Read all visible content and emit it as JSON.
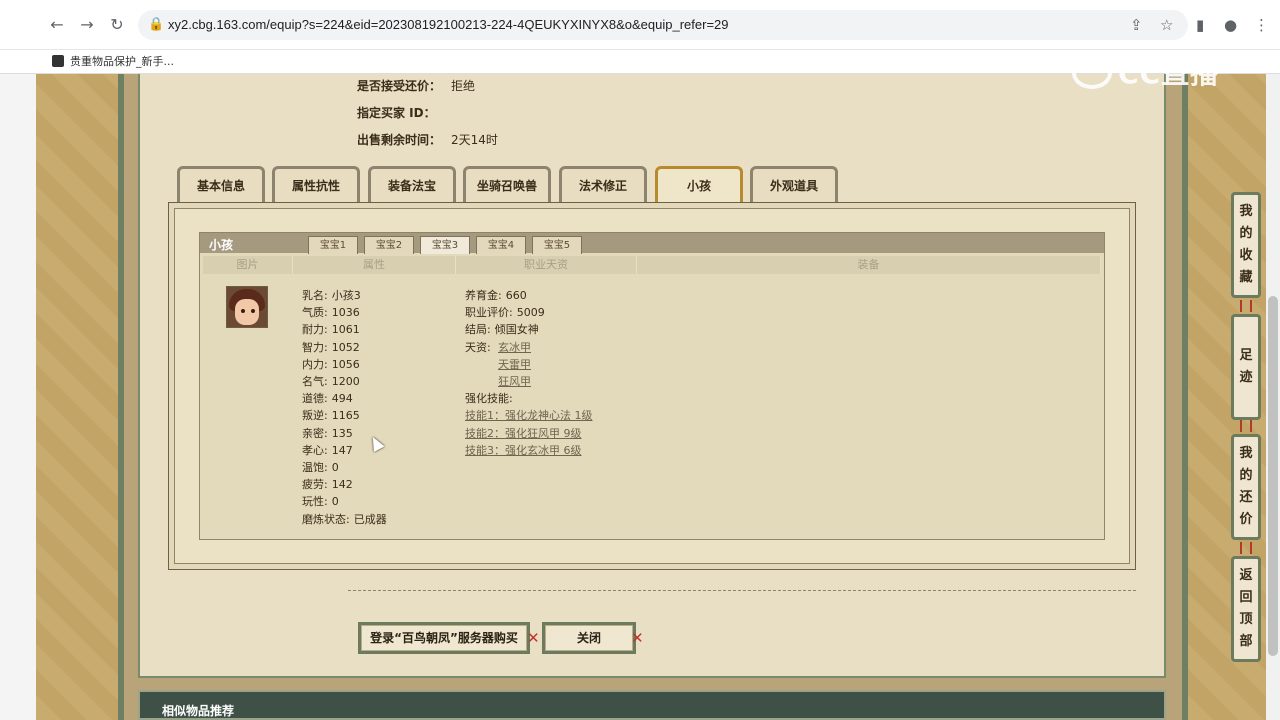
{
  "browser": {
    "url": "xy2.cbg.163.com/equip?s=224&eid=202308192100213-224-4QEUKYXINYX8&o&equip_refer=29",
    "bookmark": "贵重物品保护_新手..."
  },
  "watermark": "CC直播",
  "info": {
    "counter_offer_label": "是否接受还价：",
    "counter_offer_value": "拒绝",
    "buyer_label": "指定买家 ID：",
    "buyer_value": "",
    "remaining_label": "出售剩余时间：",
    "remaining_value": "2天14时"
  },
  "tabs": [
    "基本信息",
    "属性抗性",
    "装备法宝",
    "坐骑召唤兽",
    "法术修正",
    "小孩",
    "外观道具"
  ],
  "child": {
    "title": "小孩",
    "subtabs": [
      "宝宝1",
      "宝宝2",
      "宝宝3",
      "宝宝4",
      "宝宝5"
    ],
    "columns": [
      "图片",
      "属性",
      "职业天资",
      "装备"
    ],
    "attrs": [
      {
        "k": "乳名:",
        "v": "小孩3"
      },
      {
        "k": "气质:",
        "v": "1036"
      },
      {
        "k": "耐力:",
        "v": "1061"
      },
      {
        "k": "智力:",
        "v": "1052"
      },
      {
        "k": "内力:",
        "v": "1056"
      },
      {
        "k": "名气:",
        "v": "1200"
      },
      {
        "k": "道德:",
        "v": "494"
      },
      {
        "k": "叛逆:",
        "v": "1165"
      },
      {
        "k": "亲密:",
        "v": "135"
      },
      {
        "k": "孝心:",
        "v": "147"
      },
      {
        "k": "温饱:",
        "v": "0"
      },
      {
        "k": "疲劳:",
        "v": "142"
      },
      {
        "k": "玩性:",
        "v": "0"
      },
      {
        "k": "磨炼状态:",
        "v": "已成器"
      }
    ],
    "career": {
      "fee_label": "养育金:",
      "fee_value": "660",
      "score_label": "职业评价:",
      "score_value": "5009",
      "ending_label": "结局:",
      "ending_value": "倾国女神",
      "talent_label": "天资:",
      "talents": [
        "玄冰甲",
        "天雷甲",
        "狂风甲"
      ],
      "skills_label": "强化技能:",
      "skills": [
        "技能1：强化龙神心法 1级",
        "技能2：强化狂风甲 9级",
        "技能3：强化玄冰甲 6级"
      ]
    }
  },
  "buttons": {
    "login_buy": "登录“百鸟朝凤”服务器购买",
    "close": "关闭"
  },
  "similar_title": "相似物品推荐",
  "side": {
    "favorites": [
      "我",
      "的",
      "收",
      "藏"
    ],
    "footprint": [
      "足",
      "迹"
    ],
    "my_offer": [
      "我",
      "的",
      "还",
      "价"
    ],
    "back_top": [
      "返",
      "回",
      "顶",
      "部"
    ]
  }
}
